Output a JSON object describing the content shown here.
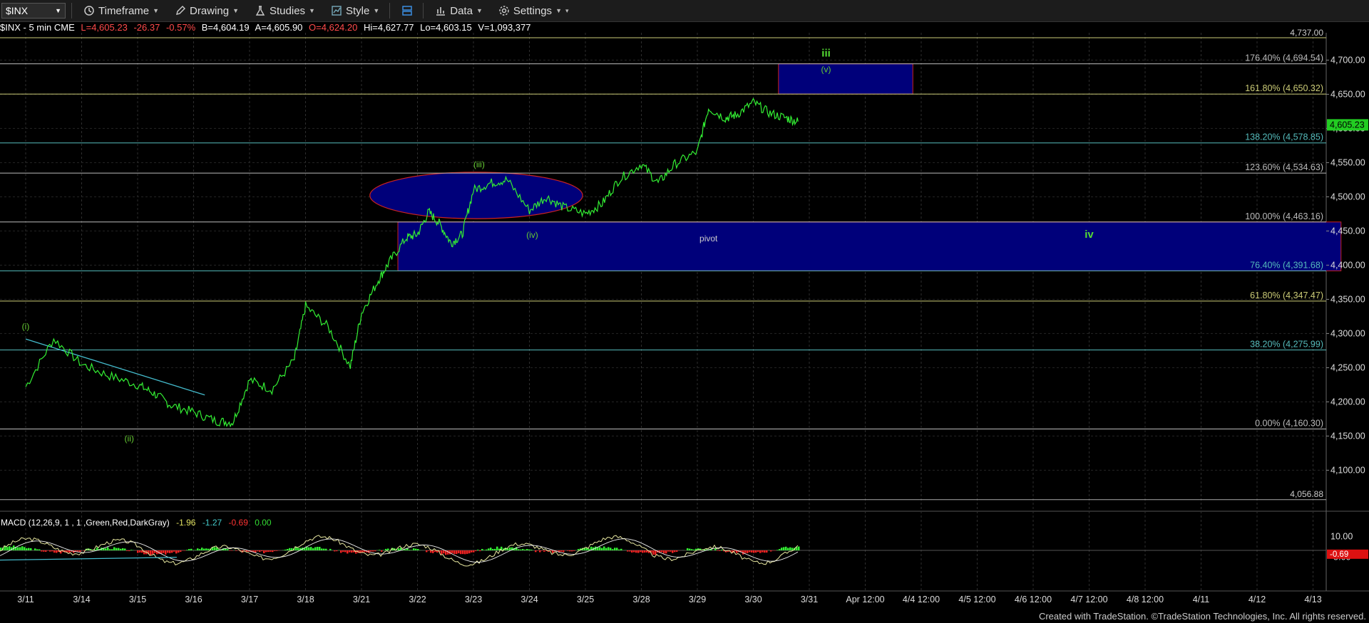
{
  "toolbar": {
    "symbol": "$INX",
    "timeframe": "Timeframe",
    "drawing": "Drawing",
    "studies": "Studies",
    "style": "Style",
    "data": "Data",
    "settings": "Settings"
  },
  "info": {
    "symbol": "$INX - 5 min  CME",
    "last": "L=4,605.23",
    "change": "-26.37",
    "pct": "-0.57%",
    "bid": "B=4,604.19",
    "ask": "A=4,605.90",
    "open": "O=4,624.20",
    "hi": "Hi=4,627.77",
    "lo": "Lo=4,603.15",
    "vol": "V=1,093,377"
  },
  "macd_legend": {
    "label": "MACD (12,26,9, 1 , 1 ,Green,Red,DarkGray)",
    "v1": "-1.96",
    "v2": "-1.27",
    "v3": "-0.69",
    "v4": "0.00"
  },
  "footer": "Created with TradeStation. ©TradeStation Technologies, Inc. All rights reserved.",
  "colors": {
    "price": "#33ee33",
    "zone_fill": "#00007a",
    "zone_border": "#cc2222",
    "label_green": "#66cc33",
    "macd_pos": "#33ee33",
    "macd_neg": "#ee2222"
  },
  "chart_data": {
    "type": "line",
    "title": "",
    "xlabel": "",
    "ylabel": "",
    "ylim": [
      4040,
      4740
    ],
    "y_ticks": [
      "4,100.00",
      "4,150.00",
      "4,200.00",
      "4,250.00",
      "4,300.00",
      "4,350.00",
      "4,400.00",
      "4,450.00",
      "4,500.00",
      "4,550.00",
      "4,600.00",
      "4,650.00",
      "4,700.00"
    ],
    "y_tick_values": [
      4100,
      4150,
      4200,
      4250,
      4300,
      4350,
      4400,
      4450,
      4500,
      4550,
      4600,
      4650,
      4700
    ],
    "x_ticks": [
      "3/11",
      "3/14",
      "3/15",
      "3/16",
      "3/17",
      "3/18",
      "3/21",
      "3/22",
      "3/23",
      "3/24",
      "3/25",
      "3/28",
      "3/29",
      "3/30",
      "3/31",
      "Apr 12:00",
      "4/4 12:00",
      "4/5 12:00",
      "4/6 12:00",
      "4/7 12:00",
      "4/8 12:00",
      "4/11",
      "4/12",
      "4/13"
    ],
    "last_price": 4605.23,
    "last_price_label": "4,605.23",
    "top_level_label": "4,737.00",
    "bottom_level": 4056.88,
    "bottom_level_label": "4,056.88",
    "fib_levels": [
      {
        "value": 4694.54,
        "label": "176.40% (4,694.54)",
        "color": "#bbbbbb"
      },
      {
        "value": 4650.32,
        "label": "161.80% (4,650.32)",
        "color": "#cccc77"
      },
      {
        "value": 4578.85,
        "label": "138.20% (4,578.85)",
        "color": "#55bbbb"
      },
      {
        "value": 4534.63,
        "label": "123.60% (4,534.63)",
        "color": "#bbbbbb"
      },
      {
        "value": 4463.16,
        "label": "100.00% (4,463.16)",
        "color": "#bbbbbb"
      },
      {
        "value": 4391.68,
        "label": "76.40% (4,391.68)",
        "color": "#55bbbb"
      },
      {
        "value": 4347.47,
        "label": "61.80% (4,347.47)",
        "color": "#cccc77"
      },
      {
        "value": 4275.99,
        "label": "38.20% (4,275.99)",
        "color": "#55bbbb"
      },
      {
        "value": 4160.3,
        "label": "0.00% (4,160.30)",
        "color": "#bbbbbb"
      }
    ],
    "price_series": {
      "x": [
        0,
        0.5,
        1,
        1.5,
        2,
        2.3,
        2.6,
        3,
        3.4,
        3.7,
        4,
        4.4,
        4.8,
        5,
        5.4,
        5.8,
        6,
        6.3,
        6.5,
        6.8,
        7,
        7.2,
        7.4,
        7.6,
        7.8,
        8,
        8.3,
        8.6,
        9,
        9.3,
        9.6,
        10,
        10.3,
        10.6,
        11,
        11.3,
        11.6,
        12,
        12.2,
        12.5,
        12.7,
        13,
        13.3,
        13.6,
        13.8
      ],
      "y": [
        4222,
        4292,
        4255,
        4238,
        4225,
        4212,
        4195,
        4185,
        4172,
        4170,
        4232,
        4218,
        4262,
        4340,
        4310,
        4252,
        4330,
        4378,
        4405,
        4440,
        4445,
        4478,
        4460,
        4432,
        4445,
        4510,
        4520,
        4525,
        4480,
        4500,
        4485,
        4475,
        4490,
        4525,
        4548,
        4520,
        4548,
        4566,
        4630,
        4615,
        4620,
        4638,
        4622,
        4615,
        4610
      ]
    },
    "zones": [
      {
        "name": "pivot",
        "x0": 6.65,
        "x1": 23.5,
        "y0": 4463.16,
        "y1": 4391.68
      },
      {
        "name": "iii-target",
        "x0": 13.45,
        "x1": 15.85,
        "y0": 4694.54,
        "y1": 4650.32
      },
      {
        "name": "ellipse",
        "cx": 8.05,
        "cy": 4502,
        "rx": 1.9,
        "ry": 34
      }
    ],
    "annotations": [
      {
        "text": "(i)",
        "x": 0.0,
        "y": 4306
      },
      {
        "text": "(ii)",
        "x": 1.85,
        "y": 4142
      },
      {
        "text": "(iii)",
        "x": 8.1,
        "y": 4543
      },
      {
        "text": "(iv)",
        "x": 9.05,
        "y": 4440
      },
      {
        "text": "iii",
        "x": 14.3,
        "y": 4705
      },
      {
        "text": "(v)",
        "x": 14.3,
        "y": 4682
      },
      {
        "text": "pivot",
        "x": 12.2,
        "y": 4435
      },
      {
        "text": "iv",
        "x": 19.0,
        "y": 4440
      }
    ],
    "trendline": {
      "x0": 0.0,
      "y0": 4292,
      "x1": 3.2,
      "y1": 4210
    },
    "macd": {
      "ylim": [
        -18,
        18
      ],
      "y_ticks": [
        "10.00",
        "-5.00"
      ],
      "y_tick_values": [
        10,
        -5
      ],
      "last_label": "-0.69"
    }
  }
}
